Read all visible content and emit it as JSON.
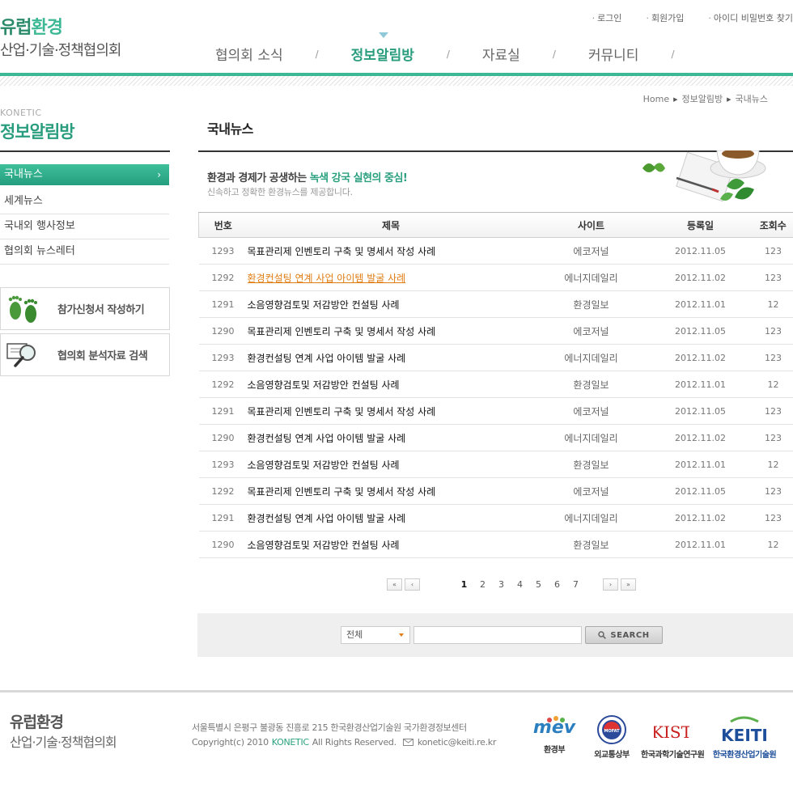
{
  "header": {
    "logo_line1_a": "유럽",
    "logo_line1_b": "환경",
    "logo_line2": "산업·기술·정책협의회",
    "util": [
      "로그인",
      "회원가입",
      "아이디 비밀번호 찾기"
    ],
    "gnb": [
      "협의회 소식",
      "정보알림방",
      "자료실",
      "커뮤니티"
    ],
    "gnb_separator": "/",
    "accent": "#3db895"
  },
  "sidebar": {
    "en_title": "KONETIC",
    "title": "정보알림방",
    "items": [
      "국내뉴스",
      "세계뉴스",
      "국내외 행사정보",
      "협의회 뉴스레터"
    ],
    "active_arrow": "›",
    "quick": [
      "참가신청서 작성하기",
      "협의회 분석자료 검색"
    ]
  },
  "breadcrumb": [
    "Home",
    "정보알림방",
    "국내뉴스"
  ],
  "content": {
    "title": "국내뉴스",
    "intro_a": "환경과 경제가 공생하는 ",
    "intro_hl": "녹색 강국 실현의 중심!",
    "intro_sub": "신속하고 정확한 환경뉴스를 제공합니다."
  },
  "table": {
    "headers": [
      "번호",
      "제목",
      "사이트",
      "등록일",
      "조회수"
    ],
    "rows": [
      {
        "no": "1293",
        "title": "목표관리제 인벤토리 구축 및 명세서 작성 사례",
        "site": "에코저널",
        "date": "2012.11.05",
        "views": "123"
      },
      {
        "no": "1292",
        "title": "환경컨설팅 연계 사업 아이템 발굴 사례",
        "site": "에너지데일리",
        "date": "2012.11.02",
        "views": "123"
      },
      {
        "no": "1291",
        "title": "소음영향검토및 저감방안 컨설팅 사례",
        "site": "환경일보",
        "date": "2012.11.01",
        "views": "12"
      },
      {
        "no": "1290",
        "title": "목표관리제 인벤토리 구축 및 명세서 작성 사례",
        "site": "에코저널",
        "date": "2012.11.05",
        "views": "123"
      },
      {
        "no": "1293",
        "title": "환경컨설팅 연계 사업 아이템 발굴 사례",
        "site": "에너지데일리",
        "date": "2012.11.02",
        "views": "123"
      },
      {
        "no": "1292",
        "title": "소음영향검토및 저감방안 컨설팅 사례",
        "site": "환경일보",
        "date": "2012.11.01",
        "views": "12"
      },
      {
        "no": "1291",
        "title": "목표관리제 인벤토리 구축 및 명세서 작성 사례",
        "site": "에코저널",
        "date": "2012.11.05",
        "views": "123"
      },
      {
        "no": "1290",
        "title": "환경컨설팅 연계 사업 아이템 발굴 사례",
        "site": "에너지데일리",
        "date": "2012.11.02",
        "views": "123"
      },
      {
        "no": "1293",
        "title": "소음영향검토및 저감방안 컨설팅 사례",
        "site": "환경일보",
        "date": "2012.11.01",
        "views": "12"
      },
      {
        "no": "1292",
        "title": "목표관리제 인벤토리 구축 및 명세서 작성 사례",
        "site": "에코저널",
        "date": "2012.11.05",
        "views": "123"
      },
      {
        "no": "1291",
        "title": "환경컨설팅 연계 사업 아이템 발굴 사례",
        "site": "에너지데일리",
        "date": "2012.11.02",
        "views": "123"
      },
      {
        "no": "1290",
        "title": "소음영향검토및 저감방안 컨설팅 사례",
        "site": "환경일보",
        "date": "2012.11.01",
        "views": "12"
      }
    ],
    "highlight_row": 1,
    "highlight_color": "#e07c12"
  },
  "paging": {
    "first": "«",
    "prev": "‹",
    "next": "›",
    "last": "»",
    "pages": [
      "1",
      "2",
      "3",
      "4",
      "5",
      "6",
      "7"
    ],
    "current": "1"
  },
  "search": {
    "select_value": "전체",
    "input_value": "",
    "button_label": "SEARCH"
  },
  "footer": {
    "logo_line1": "유럽환경",
    "logo_line2": "산업·기술·정책협의회",
    "address": "서울특별시 은평구 불광동 진흥로 215 한국환경산업기술원 국가환경정보센터",
    "copyright_a": "Copyright(c) 2010",
    "copyright_brand": "KONETIC",
    "copyright_b": "All Rights Reserved.",
    "email": "konetic@keiti.re.kr",
    "partners": [
      {
        "logo": "mev",
        "caption": "환경부"
      },
      {
        "logo": "MOFAT",
        "caption": "외교통상부"
      },
      {
        "logo": "KIST",
        "caption": "한국과학기술연구원"
      },
      {
        "logo": "KEITI",
        "caption": "한국환경산업기술원"
      }
    ]
  }
}
